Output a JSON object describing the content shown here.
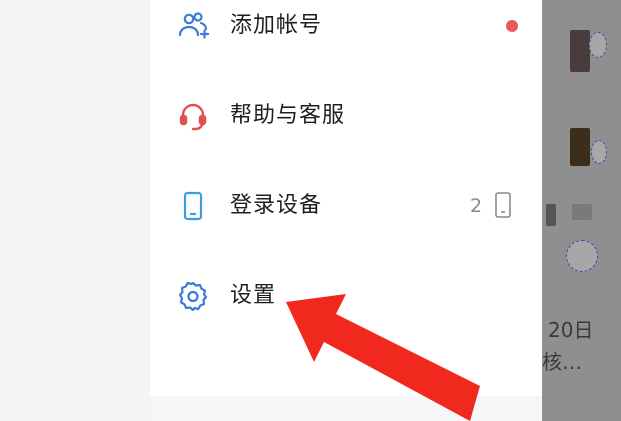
{
  "menu": {
    "items": [
      {
        "label": "添加帐号",
        "icon": "add-account-icon",
        "badge": "red-dot"
      },
      {
        "label": "帮助与客服",
        "icon": "headset-icon"
      },
      {
        "label": "登录设备",
        "icon": "phone-icon",
        "count": "2"
      },
      {
        "label": "设置",
        "icon": "gear-icon"
      }
    ]
  },
  "background": {
    "date_text": "20日",
    "snippet_text": "核…"
  },
  "colors": {
    "accent": "#3b7ad8",
    "help_icon": "#e0504e",
    "badge": "#e85a5f",
    "annotation_arrow": "#f0281e"
  }
}
